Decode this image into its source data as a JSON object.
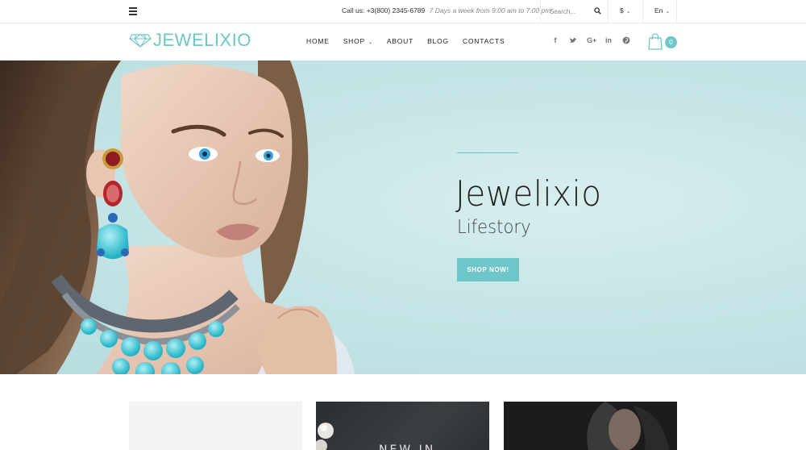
{
  "topbar": {
    "menu_icon": "hamburger-icon",
    "contact_label": "Call us: +3(800) 2345-6789",
    "contact_hours": "7 Days a week from 9:00 am to 7:00 pm",
    "search": {
      "placeholder": "Search...",
      "icon": "search-icon"
    },
    "currency": {
      "selected": "$",
      "icon": "chevron-down-icon"
    },
    "language": {
      "selected": "En",
      "icon": "chevron-down-icon"
    }
  },
  "header": {
    "logo_text": "JEWELIXIO",
    "logo_icon": "diamond-icon",
    "nav": [
      {
        "label": "HOME"
      },
      {
        "label": "SHOP",
        "has_dropdown": true
      },
      {
        "label": "ABOUT"
      },
      {
        "label": "BLOG"
      },
      {
        "label": "CONTACTS"
      }
    ],
    "social": [
      {
        "name": "facebook-icon",
        "glyph": "f"
      },
      {
        "name": "twitter-icon",
        "glyph": "t"
      },
      {
        "name": "google-plus-icon",
        "glyph": "G+"
      },
      {
        "name": "linkedin-icon",
        "glyph": "in"
      },
      {
        "name": "pinterest-icon",
        "glyph": "p"
      }
    ],
    "cart": {
      "icon": "shopping-bag-icon",
      "count": "0"
    }
  },
  "hero": {
    "title": "Jewelixio",
    "subtitle": "Lifestory",
    "cta_label": "SHOP NOW!",
    "image": "model-with-jewelry-image"
  },
  "banners": [
    {
      "name": "banner-light"
    },
    {
      "name": "banner-new-in",
      "label": "NEW IN"
    },
    {
      "name": "banner-model"
    }
  ],
  "colors": {
    "accent": "#6fc6c9",
    "hero_bg": "#c7e5e6",
    "text_dark": "#222222"
  }
}
